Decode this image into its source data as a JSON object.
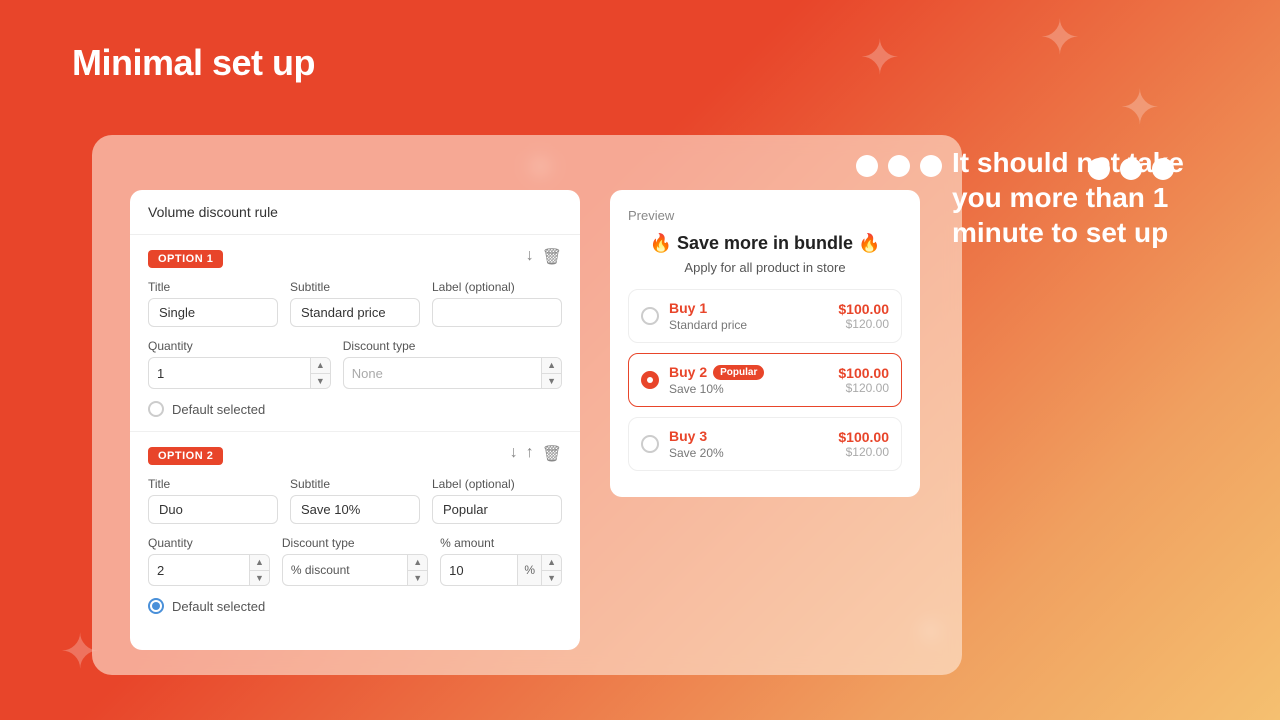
{
  "page": {
    "title": "Minimal set up",
    "background": "#e8452a"
  },
  "sidebar_text": "It should not take you more than 1 minute to set up",
  "panel_header": "Volume discount rule",
  "option1": {
    "badge": "OPTION 1",
    "title_label": "Title",
    "title_value": "Single",
    "subtitle_label": "Subtitle",
    "subtitle_value": "Standard price",
    "label_label": "Label (optional)",
    "label_value": "",
    "quantity_label": "Quantity",
    "quantity_value": "1",
    "discount_type_label": "Discount type",
    "discount_type_value": "None",
    "default_label": "Default selected",
    "default_checked": false
  },
  "option2": {
    "badge": "OPTION 2",
    "title_label": "Title",
    "title_value": "Duo",
    "subtitle_label": "Subtitle",
    "subtitle_value": "Save 10%",
    "label_label": "Label (optional)",
    "label_value": "Popular",
    "quantity_label": "Quantity",
    "quantity_value": "2",
    "discount_type_label": "Discount type",
    "discount_type_value": "% discount",
    "amount_label": "% amount",
    "amount_value": "10",
    "default_label": "Default selected",
    "default_checked": true
  },
  "preview": {
    "label": "Preview",
    "title": "🔥 Save more in bundle 🔥",
    "subtitle": "Apply for all product in store",
    "options": [
      {
        "name": "Buy 1",
        "desc": "Standard price",
        "price": "$100.00",
        "orig_price": "$120.00",
        "selected": false,
        "popular": false
      },
      {
        "name": "Buy 2",
        "desc": "Save 10%",
        "price": "$100.00",
        "orig_price": "$120.00",
        "selected": true,
        "popular": true,
        "popular_label": "Popular"
      },
      {
        "name": "Buy 3",
        "desc": "Save 20%",
        "price": "$100.00",
        "orig_price": "$120.00",
        "selected": false,
        "popular": false
      }
    ]
  }
}
